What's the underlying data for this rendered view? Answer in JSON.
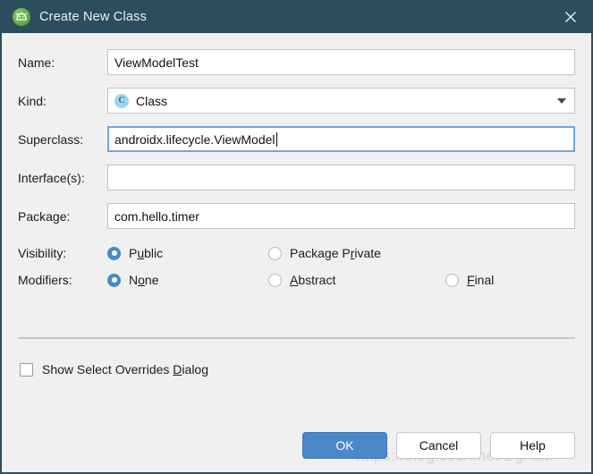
{
  "window": {
    "title": "Create New Class",
    "app_icon": "android-studio-icon",
    "close_label": "✕",
    "titlebar_color": "#2b4d5c",
    "background_color": "#f0f0f0",
    "accent_color": "#4a88c7"
  },
  "fields": {
    "name": {
      "label": "Name:",
      "value": "ViewModelTest",
      "placeholder": ""
    },
    "kind": {
      "label": "Kind:",
      "value": "Class",
      "icon_letter": "C",
      "icon_name": "class-icon"
    },
    "superclass": {
      "label": "Superclass:",
      "value": "androidx.lifecycle.ViewModel",
      "placeholder": "",
      "focused": true
    },
    "interfaces": {
      "label": "Interface(s):",
      "value": "",
      "placeholder": ""
    },
    "package": {
      "label": "Package:",
      "value": "com.hello.timer",
      "placeholder": ""
    }
  },
  "visibility": {
    "label": "Visibility:",
    "options": [
      {
        "pre": "P",
        "mnemonic": "u",
        "post": "blic",
        "selected": true
      },
      {
        "pre": "Package P",
        "mnemonic": "r",
        "post": "ivate",
        "selected": false
      }
    ]
  },
  "modifiers": {
    "label": "Modifiers:",
    "options": [
      {
        "pre": "N",
        "mnemonic": "o",
        "post": "ne",
        "selected": true
      },
      {
        "pre": "",
        "mnemonic": "A",
        "post": "bstract",
        "selected": false
      },
      {
        "pre": "",
        "mnemonic": "F",
        "post": "inal",
        "selected": false
      }
    ]
  },
  "overrides": {
    "checked": false,
    "pre": "Show Select Overrides ",
    "mnemonic": "D",
    "post": "ialog"
  },
  "buttons": {
    "ok": "OK",
    "cancel": "Cancel",
    "help": "Help"
  },
  "watermark": {
    "text": "https://blog.csdn.net/BgnaM"
  }
}
